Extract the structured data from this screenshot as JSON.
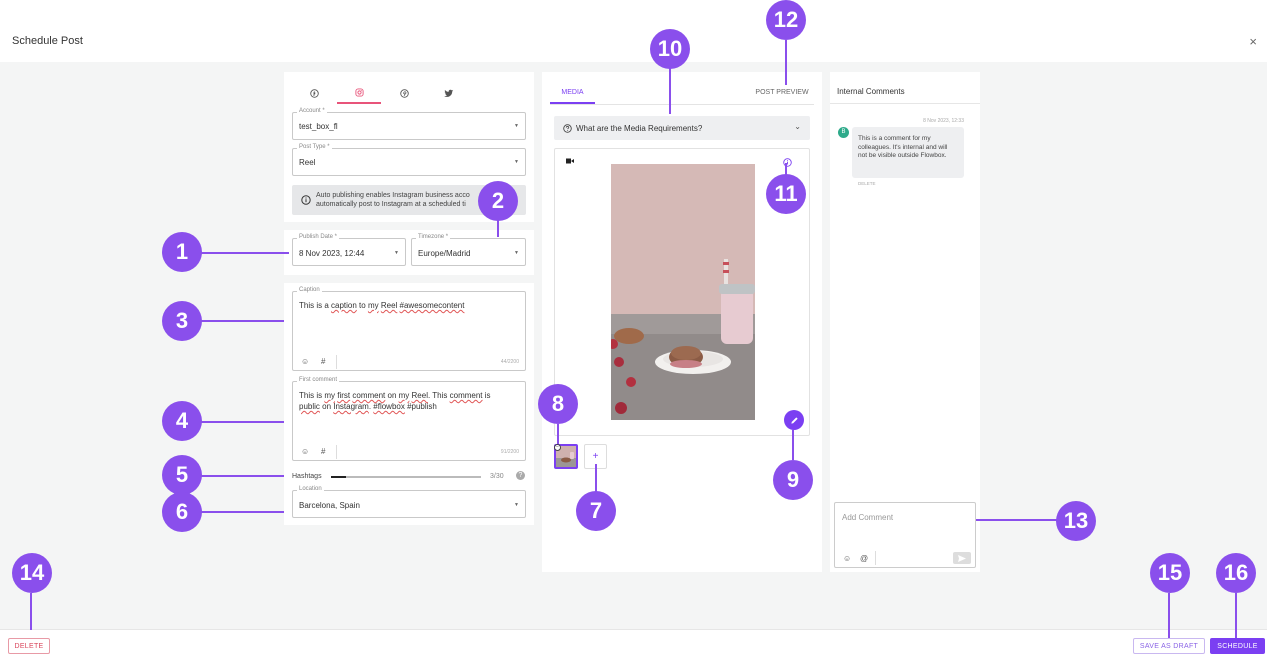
{
  "window": {
    "title": "Schedule Post",
    "close_glyph": "×"
  },
  "social_tabs": [
    {
      "name": "facebook",
      "icon": "facebook-icon",
      "active": false
    },
    {
      "name": "instagram",
      "icon": "instagram-icon",
      "active": true
    },
    {
      "name": "pinterest",
      "icon": "pinterest-icon",
      "active": false
    },
    {
      "name": "twitter",
      "icon": "twitter-icon",
      "active": false
    }
  ],
  "form": {
    "account": {
      "label": "Account *",
      "value": "test_box_fl"
    },
    "post_type": {
      "label": "Post Type *",
      "value": "Reel"
    },
    "info_text_1": "Auto publishing enables Instagram business acco",
    "info_text_2": "automatically post to Instagram at a scheduled ti",
    "publish_date": {
      "label": "Publish Date *",
      "value": "8 Nov 2023, 12:44"
    },
    "timezone": {
      "label": "Timezone *",
      "value": "Europe/Madrid"
    },
    "caption": {
      "label": "Caption",
      "count": "44/2200"
    },
    "first_comment": {
      "label": "First comment",
      "count": "91/2200"
    },
    "hashtags": {
      "label": "Hashtags",
      "count": "3/30",
      "fraction": 0.1
    },
    "location": {
      "label": "Location",
      "value": "Barcelona, Spain"
    }
  },
  "media": {
    "tab_media": "MEDIA",
    "tab_preview": "POST PREVIEW",
    "requirements": "What are the Media Requirements?",
    "add_glyph": "+"
  },
  "comments": {
    "title": "Internal Comments",
    "timestamp": "8 Nov 2023, 12:33",
    "avatar": "B",
    "text": "This is a comment for my colleagues. It's internal and will not be visible outside Flowbox.",
    "delete": "DELETE",
    "placeholder": "Add Comment"
  },
  "footer": {
    "delete": "DELETE",
    "save_draft": "SAVE AS DRAFT",
    "schedule": "SCHEDULE"
  },
  "callouts": [
    "1",
    "2",
    "3",
    "4",
    "5",
    "6",
    "7",
    "8",
    "9",
    "10",
    "11",
    "12",
    "13",
    "14",
    "15",
    "16"
  ],
  "colors": {
    "accent": "#7b3ff2",
    "callout": "#8a4fec",
    "instagram": "#e8547a",
    "delete": "#d9455b"
  }
}
